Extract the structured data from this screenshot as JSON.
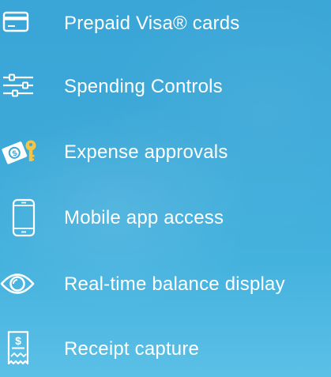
{
  "features": [
    {
      "label": "Prepaid Visa® cards",
      "icon": "credit-card-icon"
    },
    {
      "label": "Spending Controls",
      "icon": "sliders-icon"
    },
    {
      "label": "Expense approvals",
      "icon": "money-key-icon"
    },
    {
      "label": "Mobile app access",
      "icon": "mobile-phone-icon"
    },
    {
      "label": "Real-time balance display",
      "icon": "eye-icon"
    },
    {
      "label": "Receipt capture",
      "icon": "receipt-icon"
    }
  ],
  "colors": {
    "background": "#3ba8d8",
    "text": "#ffffff",
    "key_accent": "#f6c445"
  }
}
